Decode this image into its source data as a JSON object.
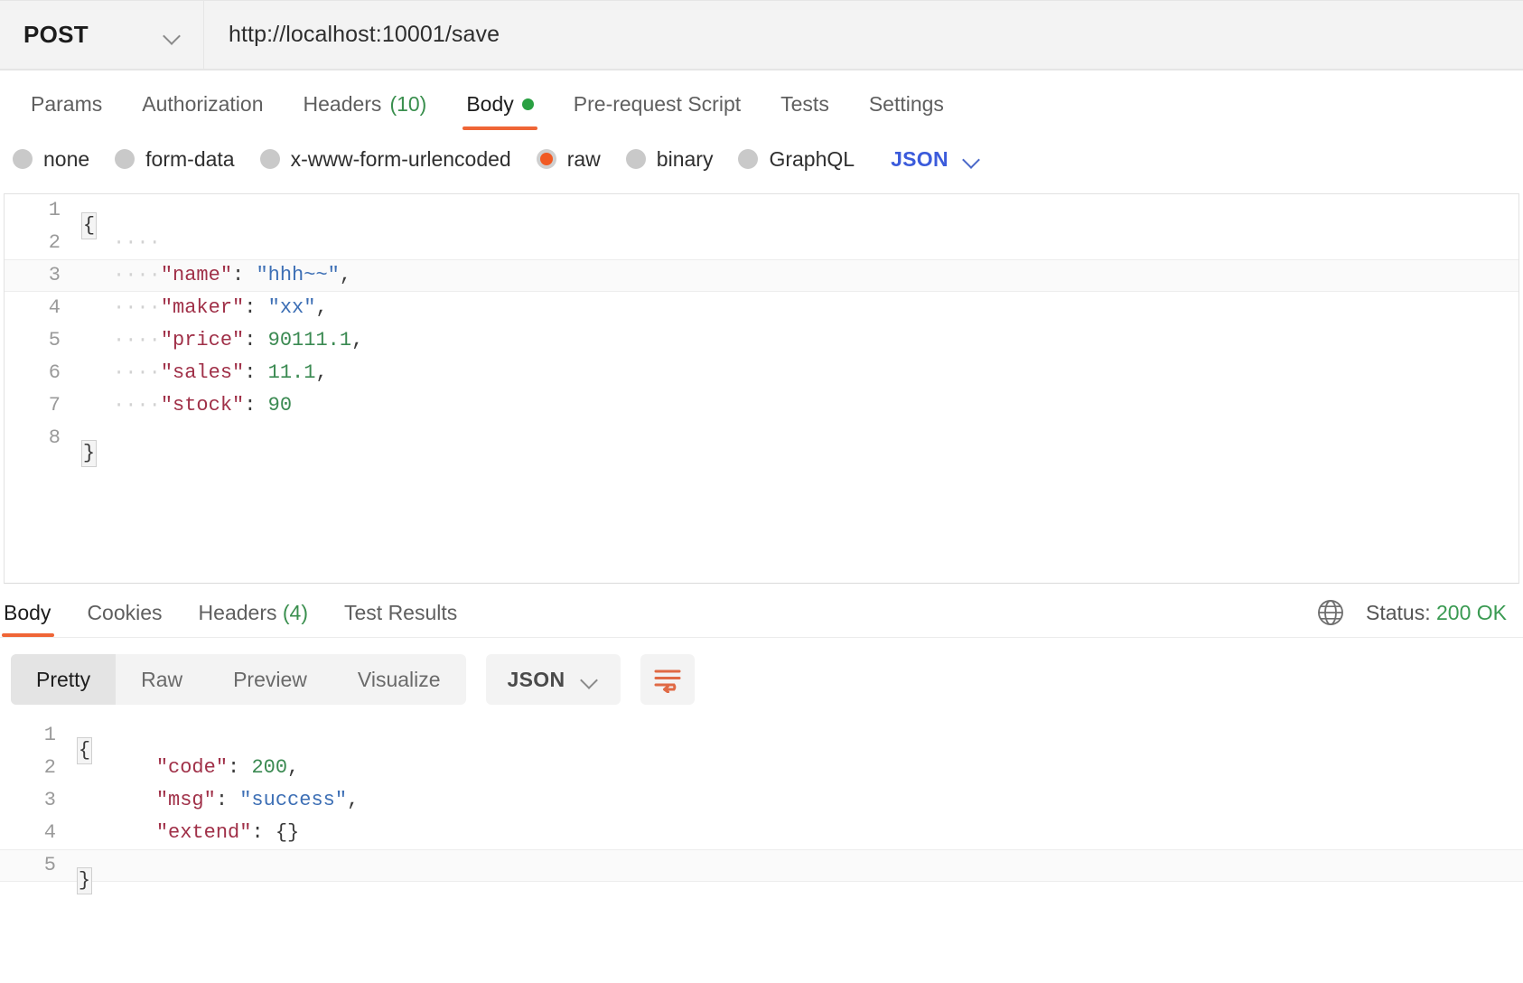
{
  "request_bar": {
    "method": "POST",
    "method_icon": "chevron-down-icon",
    "url": "http://localhost:10001/save"
  },
  "request_tabs": [
    {
      "label": "Params",
      "active": false
    },
    {
      "label": "Authorization",
      "active": false
    },
    {
      "label": "Headers",
      "count": "(10)",
      "active": false
    },
    {
      "label": "Body",
      "active": true,
      "dot": true
    },
    {
      "label": "Pre-request Script",
      "active": false
    },
    {
      "label": "Tests",
      "active": false
    },
    {
      "label": "Settings",
      "active": false
    }
  ],
  "body_types": [
    {
      "label": "none",
      "selected": false
    },
    {
      "label": "form-data",
      "selected": false
    },
    {
      "label": "x-www-form-urlencoded",
      "selected": false
    },
    {
      "label": "raw",
      "selected": true
    },
    {
      "label": "binary",
      "selected": false
    },
    {
      "label": "GraphQL",
      "selected": false
    }
  ],
  "body_format": {
    "label": "JSON",
    "icon": "chevron-down-icon",
    "color": "#3b5bdb"
  },
  "request_body": {
    "lines": [
      {
        "n": "1",
        "bracket": "{",
        "text": ""
      },
      {
        "n": "2",
        "text": "····"
      },
      {
        "n": "3",
        "text": "····\"name\": \"hhh~~\",",
        "highlight": true
      },
      {
        "n": "4",
        "text": "····\"maker\": \"xx\","
      },
      {
        "n": "5",
        "text": "····\"price\": 90111.1,"
      },
      {
        "n": "6",
        "text": "····\"sales\": 11.1,"
      },
      {
        "n": "7",
        "text": "····\"stock\": 90"
      },
      {
        "n": "8",
        "bracket": "}",
        "text": ""
      }
    ],
    "raw": "{\n    \n    \"name\": \"hhh~~\",\n    \"maker\": \"xx\",\n    \"price\": 90111.1,\n    \"sales\": 11.1,\n    \"stock\": 90\n}"
  },
  "response_tabs": [
    {
      "label": "Body",
      "active": true
    },
    {
      "label": "Cookies",
      "active": false
    },
    {
      "label": "Headers",
      "count": "(4)",
      "active": false
    },
    {
      "label": "Test Results",
      "active": false
    }
  ],
  "response_status": {
    "icon": "globe-icon",
    "prefix": "Status:",
    "value": "200 OK",
    "color": "#3a9a52"
  },
  "response_view_tabs": [
    {
      "label": "Pretty",
      "active": true
    },
    {
      "label": "Raw",
      "active": false
    },
    {
      "label": "Preview",
      "active": false
    },
    {
      "label": "Visualize",
      "active": false
    }
  ],
  "response_format": {
    "label": "JSON",
    "icon": "chevron-down-icon"
  },
  "response_actions": {
    "wrap_icon": "wrap-lines-icon",
    "wrap_icon_color": "#e06a45"
  },
  "response_body": {
    "lines": [
      {
        "n": "1",
        "bracket": "{",
        "text": ""
      },
      {
        "n": "2",
        "text": "    \"code\": 200,"
      },
      {
        "n": "3",
        "text": "    \"msg\": \"success\","
      },
      {
        "n": "4",
        "text": "    \"extend\": {}"
      },
      {
        "n": "5",
        "bracket": "}",
        "text": ""
      }
    ],
    "raw": "{\n    \"code\": 200,\n    \"msg\": \"success\",\n    \"extend\": {}\n}"
  }
}
